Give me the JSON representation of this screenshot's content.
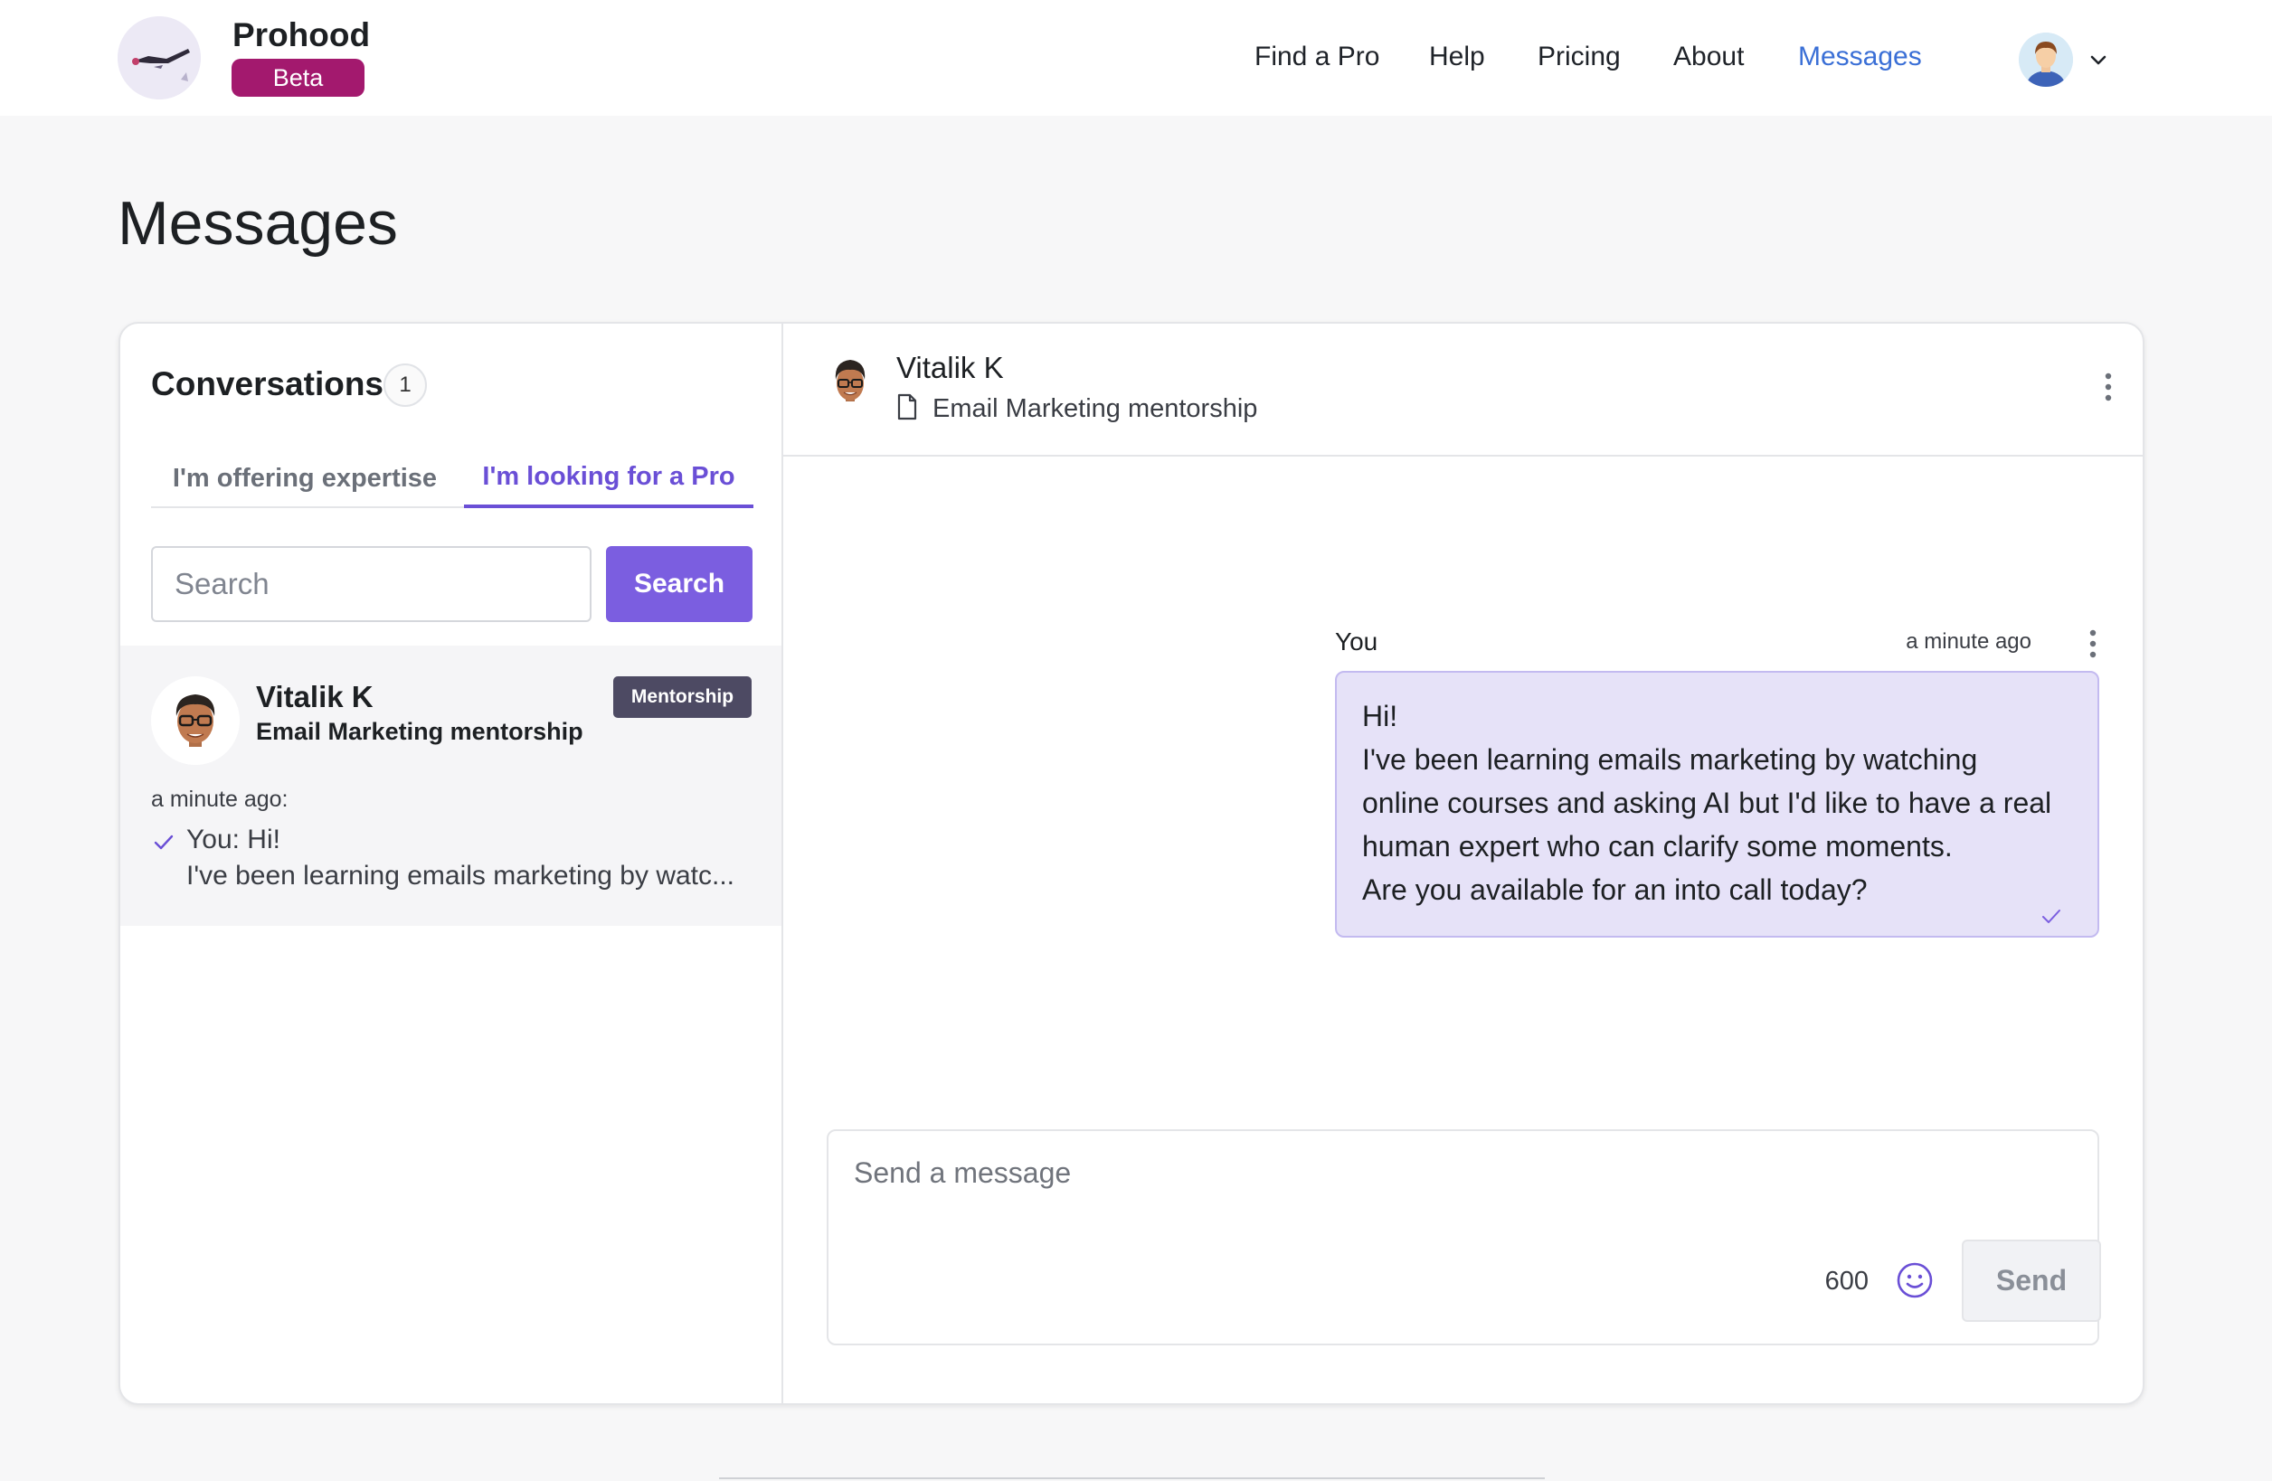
{
  "header": {
    "brand": "Prohood",
    "badge": "Beta",
    "nav": [
      {
        "label": "Find a Pro",
        "active": false
      },
      {
        "label": "Help",
        "active": false
      },
      {
        "label": "Pricing",
        "active": false
      },
      {
        "label": "About",
        "active": false
      },
      {
        "label": "Messages",
        "active": true
      }
    ]
  },
  "page": {
    "title": "Messages"
  },
  "conversations": {
    "title": "Conversations",
    "count": "1",
    "tabs": [
      {
        "label": "I'm offering expertise",
        "active": false
      },
      {
        "label": "I'm looking for a Pro",
        "active": true
      }
    ],
    "search": {
      "placeholder": "Search",
      "button_label": "Search"
    },
    "items": [
      {
        "name": "Vitalik K",
        "subject": "Email Marketing mentorship",
        "badge": "Mentorship",
        "time": "a minute ago:",
        "preview_line1": "You: Hi!",
        "preview_line2": "I've been learning emails marketing by watc..."
      }
    ]
  },
  "chat": {
    "name": "Vitalik K",
    "subject": "Email Marketing mentorship",
    "messages": [
      {
        "sender": "You",
        "time": "a minute ago",
        "lines": [
          "Hi!",
          "I've been learning emails marketing by watching",
          "online courses and asking AI but I'd like to have a real",
          "human expert who can clarify some moments.",
          "Are you available for an into call today?"
        ]
      }
    ],
    "composer": {
      "placeholder": "Send a message",
      "char_count": "600",
      "send_label": "Send"
    }
  },
  "colors": {
    "accent": "#7b5ee0",
    "brand_badge": "#a3196e",
    "nav_active": "#3a6fd6",
    "message_bubble": "#e6e2f8",
    "tag_badge": "#4d4a63"
  },
  "icons": [
    "user-avatar-icon",
    "chevron-down-icon",
    "check-icon",
    "document-icon",
    "kebab-menu-icon",
    "emoji-icon"
  ]
}
